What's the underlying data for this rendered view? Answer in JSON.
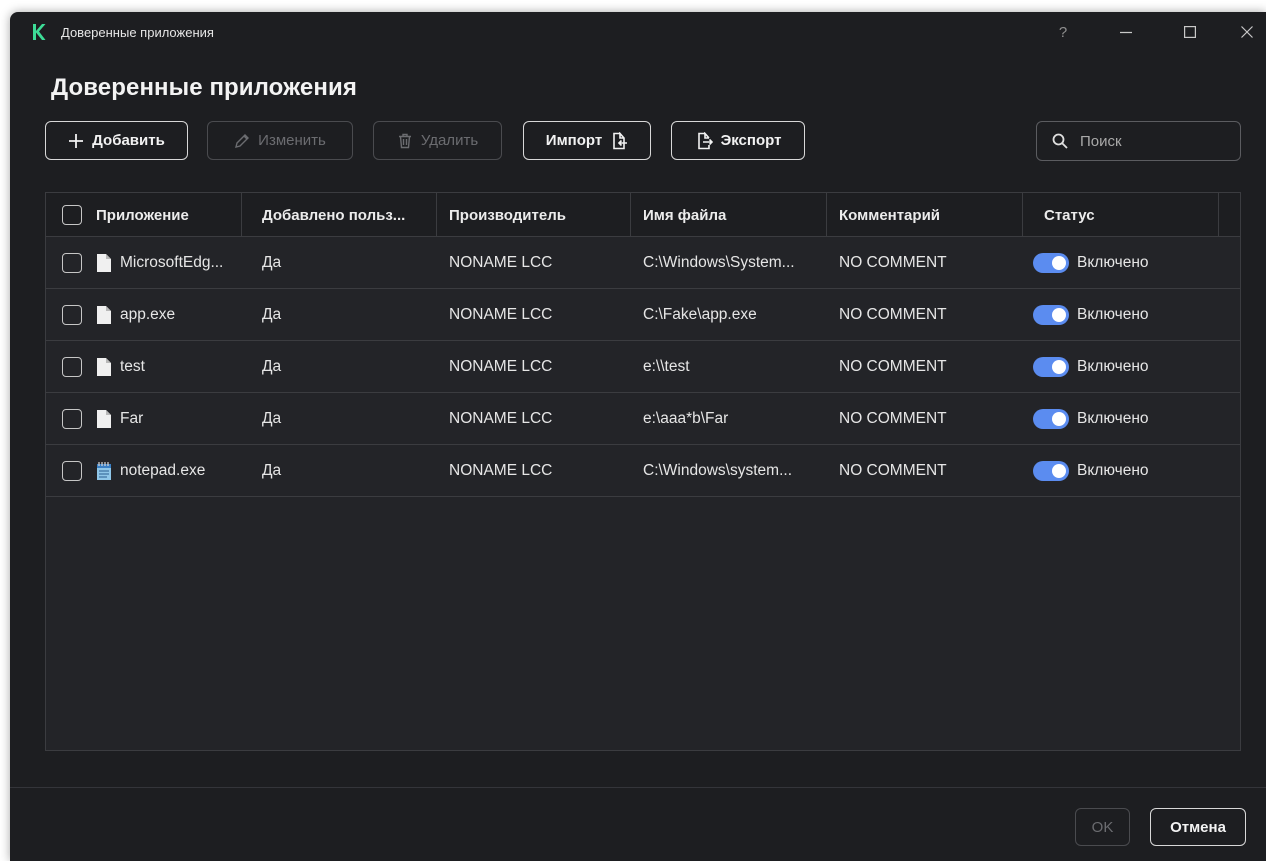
{
  "window": {
    "title": "Доверенные приложения",
    "help_glyph": "?"
  },
  "page_title": "Доверенные приложения",
  "toolbar": {
    "add": "Добавить",
    "edit": "Изменить",
    "delete": "Удалить",
    "import": "Импорт",
    "export": "Экспорт"
  },
  "search": {
    "placeholder": "Поиск"
  },
  "table": {
    "columns": [
      "Приложение",
      "Добавлено польз...",
      "Производитель",
      "Имя файла",
      "Комментарий",
      "Статус"
    ],
    "rows": [
      {
        "app": "MicrosoftEdg...",
        "added_by_user": "Да",
        "vendor": "NONAME LCC",
        "file": "C:\\Windows\\System...",
        "comment": "NO COMMENT",
        "status": "Включено",
        "enabled": true,
        "icon": "file-icon"
      },
      {
        "app": "app.exe",
        "added_by_user": "Да",
        "vendor": "NONAME LCC",
        "file": "C:\\Fake\\app.exe",
        "comment": "NO COMMENT",
        "status": "Включено",
        "enabled": true,
        "icon": "file-icon"
      },
      {
        "app": "test",
        "added_by_user": "Да",
        "vendor": "NONAME LCC",
        "file": "e:\\\\test",
        "comment": "NO COMMENT",
        "status": "Включено",
        "enabled": true,
        "icon": "file-icon"
      },
      {
        "app": "Far",
        "added_by_user": "Да",
        "vendor": "NONAME LCC",
        "file": "e:\\aaa*b\\Far",
        "comment": "NO COMMENT",
        "status": "Включено",
        "enabled": true,
        "icon": "file-icon"
      },
      {
        "app": "notepad.exe",
        "added_by_user": "Да",
        "vendor": "NONAME LCC",
        "file": "C:\\Windows\\system...",
        "comment": "NO COMMENT",
        "status": "Включено",
        "enabled": true,
        "icon": "notepad-icon"
      }
    ]
  },
  "footer": {
    "ok": "OK",
    "cancel": "Отмена"
  },
  "colors": {
    "background": "#1d1e21",
    "accent": "#5b8cf0",
    "logo": "#3ddc97"
  }
}
